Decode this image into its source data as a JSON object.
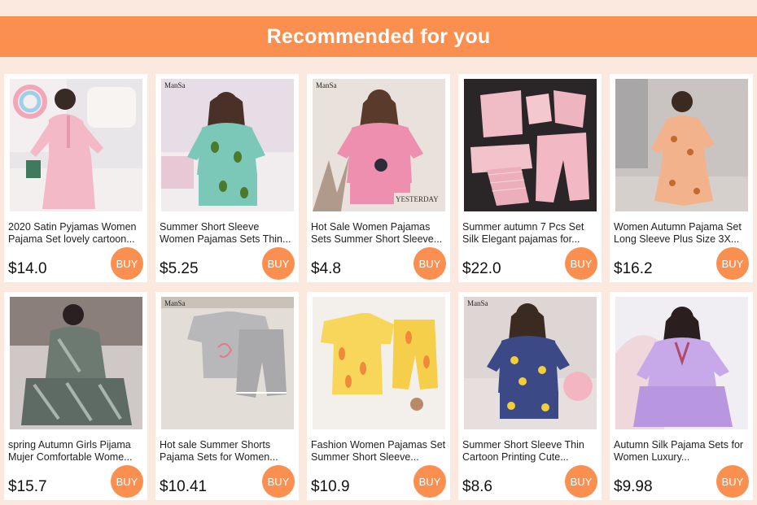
{
  "banner": {
    "title": "Recommended for you"
  },
  "buy_label": "BUY",
  "colors": {
    "accent": "#fa8f4f",
    "page_bg": "#fbe9df",
    "card_bg": "#ffffff"
  },
  "products": [
    {
      "name": "2020 Satin Pyjamas Women Pajama Set lovely cartoon...",
      "price": "$14.0",
      "brand_tag": "",
      "image": "pink-satin-pajamas-photo"
    },
    {
      "name": "Summer Short Sleeve Women Pajamas Sets Thin...",
      "price": "$5.25",
      "brand_tag": "ManSa",
      "image": "mint-avocado-pajamas-photo"
    },
    {
      "name": "Hot Sale Women Pajamas Sets Summer Short Sleeve...",
      "price": "$4.8",
      "brand_tag": "ManSa",
      "image": "pink-short-sleeve-pajamas-photo"
    },
    {
      "name": "Summer autumn 7 Pcs Set Silk Elegant pajamas for...",
      "price": "$22.0",
      "brand_tag": "",
      "image": "pink-7pcs-silk-set-photo"
    },
    {
      "name": "Women Autumn Pajama Set Long Sleeve Plus Size 3X...",
      "price": "$16.2",
      "brand_tag": "",
      "image": "peach-print-pajamas-photo"
    },
    {
      "name": "spring Autumn Girls Pijama Mujer Comfortable Wome...",
      "price": "$15.7",
      "brand_tag": "",
      "image": "leaf-print-pajamas-photo"
    },
    {
      "name": "Hot sale Summer Shorts Pajama Sets for Women...",
      "price": "$10.41",
      "brand_tag": "ManSa",
      "image": "grey-flamingo-set-photo"
    },
    {
      "name": "Fashion Women Pajamas Set Summer Short Sleeve...",
      "price": "$10.9",
      "brand_tag": "",
      "image": "yellow-carrot-set-photo"
    },
    {
      "name": "Summer Short Sleeve Thin Cartoon Printing Cute...",
      "price": "$8.6",
      "brand_tag": "ManSa",
      "image": "navy-cartoon-pajamas-photo"
    },
    {
      "name": "Autumn Silk Pajama Sets for Women Luxury...",
      "price": "$9.98",
      "brand_tag": "",
      "image": "lavender-silk-pajamas-photo"
    }
  ]
}
